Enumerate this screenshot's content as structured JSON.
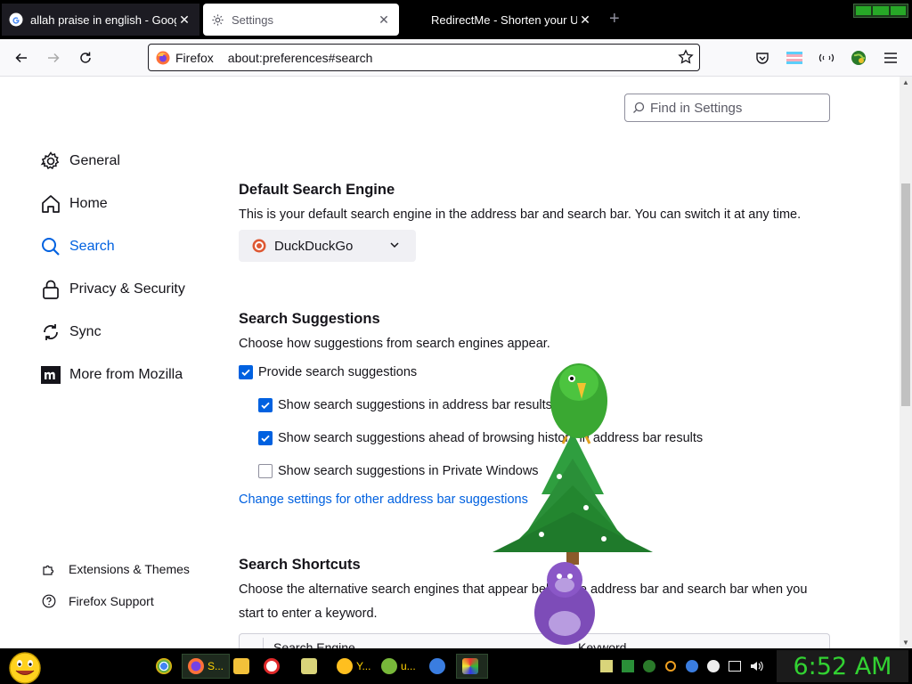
{
  "tabs": [
    {
      "title": "allah praise in english - Google",
      "close": "✕",
      "favicon": "google-icon"
    },
    {
      "title": "Settings",
      "close": "✕",
      "favicon": "gear-icon"
    },
    {
      "title": "RedirectMe - Shorten your URL",
      "close": "✕",
      "favicon": "none"
    }
  ],
  "new_tab": "+",
  "urlbar": {
    "identity": "Firefox",
    "url": "about:preferences#search"
  },
  "find": {
    "placeholder": "Find in Settings"
  },
  "sidebar": {
    "items": [
      {
        "label": "General",
        "icon": "gear-icon"
      },
      {
        "label": "Home",
        "icon": "home-icon"
      },
      {
        "label": "Search",
        "icon": "search-icon",
        "selected": true
      },
      {
        "label": "Privacy & Security",
        "icon": "lock-icon"
      },
      {
        "label": "Sync",
        "icon": "sync-icon"
      },
      {
        "label": "More from Mozilla",
        "icon": "mozilla-icon"
      }
    ],
    "footer": [
      {
        "label": "Extensions & Themes",
        "icon": "puzzle-icon"
      },
      {
        "label": "Firefox Support",
        "icon": "help-icon"
      }
    ]
  },
  "default_engine": {
    "heading": "Default Search Engine",
    "desc": "This is your default search engine in the address bar and search bar. You can switch it at any time.",
    "selected": "DuckDuckGo"
  },
  "suggestions": {
    "heading": "Search Suggestions",
    "desc": "Choose how suggestions from search engines appear.",
    "provide": {
      "label": "Provide search suggestions",
      "checked": true
    },
    "addressbar": {
      "label": "Show search suggestions in address bar results",
      "checked": true
    },
    "ahead": {
      "label": "Show search suggestions ahead of browsing history in address bar results",
      "checked": true
    },
    "private": {
      "label": "Show search suggestions in Private Windows",
      "checked": false
    },
    "link": "Change settings for other address bar suggestions"
  },
  "shortcuts": {
    "heading": "Search Shortcuts",
    "desc1": "Choose the alternative search engines that appear below the address bar and search bar when you",
    "desc2": "start to enter a keyword.",
    "col_engine": "Search Engine",
    "col_keyword": "Keyword"
  },
  "taskbar": {
    "firefox_label": "S...",
    "yahoo_label": "Y...",
    "utorrent_label": "u...",
    "clock": "6:52 AM"
  },
  "colors": {
    "accent": "#0061e0",
    "clock": "#32d232"
  }
}
